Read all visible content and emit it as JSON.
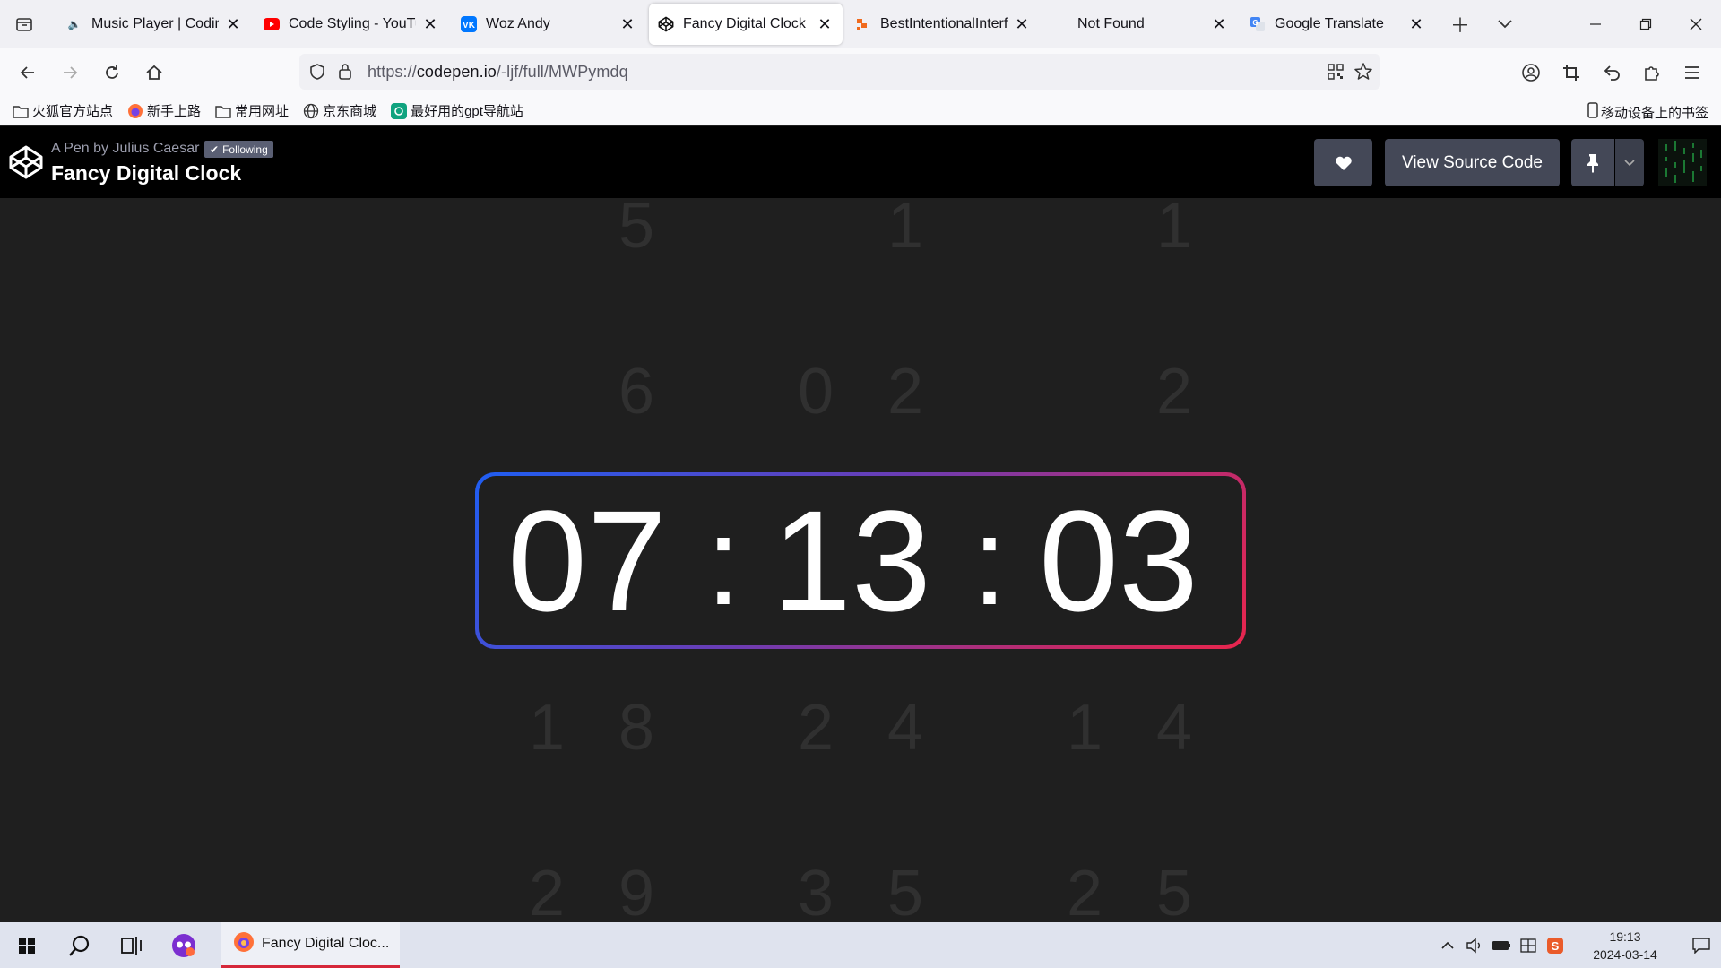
{
  "browser": {
    "tabs": [
      {
        "title": "Music Player | Codin",
        "favicon": "speaker-icon",
        "active": false
      },
      {
        "title": "Code Styling - YouTu",
        "favicon": "youtube-icon",
        "active": false
      },
      {
        "title": "Woz Andy",
        "favicon": "vk-icon",
        "active": false
      },
      {
        "title": "Fancy Digital Clock",
        "favicon": "codepen-icon",
        "active": true
      },
      {
        "title": "BestIntentionalInterf",
        "favicon": "app-icon",
        "active": false
      },
      {
        "title": "Not Found",
        "favicon": "",
        "active": false
      },
      {
        "title": "Google Translate",
        "favicon": "google-translate-icon",
        "active": false
      }
    ],
    "url": {
      "scheme": "https://",
      "host": "codepen.io",
      "path": "/-ljf/full/MWPymdq"
    },
    "bookmarks": [
      {
        "label": "火狐官方站点",
        "icon": "folder-icon"
      },
      {
        "label": "新手上路",
        "icon": "firefox-icon"
      },
      {
        "label": "常用网址",
        "icon": "folder-icon"
      },
      {
        "label": "京东商城",
        "icon": "globe-icon"
      },
      {
        "label": "最好用的gpt导航站",
        "icon": "gpt-icon"
      }
    ],
    "mobile_bookmarks": "移动设备上的书签"
  },
  "codepen": {
    "by_prefix": "A Pen by",
    "author": "Julius Caesar",
    "following_label": "Following",
    "title": "Fancy Digital Clock",
    "view_source_label": "View Source Code"
  },
  "clock": {
    "time": "07:13:03",
    "hour": "07",
    "minute": "13",
    "second": "03",
    "sep": ":",
    "gradient": [
      "#1f5ef2",
      "#6a3db5",
      "#c22a6a",
      "#e8264d"
    ],
    "background_digits": {
      "row1": [
        "5",
        "1",
        "1"
      ],
      "row2": [
        "6",
        "0",
        "2",
        "2"
      ],
      "row3": [
        "1",
        "8",
        "2",
        "4",
        "1",
        "4"
      ],
      "row4": [
        "2",
        "9",
        "3",
        "5",
        "2",
        "5"
      ]
    }
  },
  "taskbar": {
    "app_label": "Fancy Digital Cloc...",
    "time": "19:13",
    "date": "2024-03-14"
  }
}
